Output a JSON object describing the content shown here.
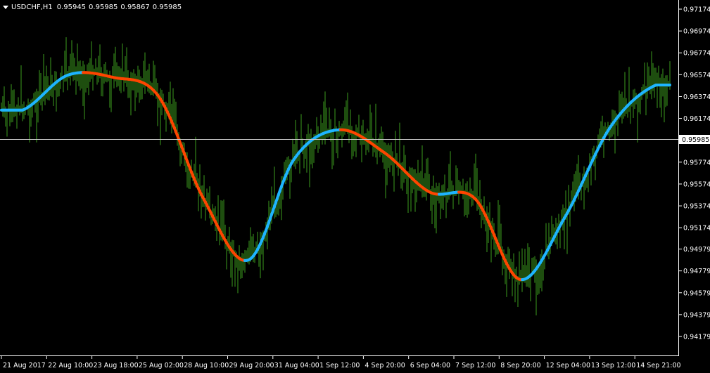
{
  "header": {
    "symbol": "USDCHF,H1",
    "open": "0.95945",
    "high": "0.95985",
    "low": "0.95867",
    "close": "0.95985"
  },
  "price_axis": {
    "ticks": [
      "0.97174",
      "0.96974",
      "0.96774",
      "0.96574",
      "0.96374",
      "0.96174",
      "0.95974",
      "0.95774",
      "0.95574",
      "0.95374",
      "0.95174",
      "0.94979",
      "0.94779",
      "0.94579",
      "0.94379",
      "0.94179"
    ],
    "current_price": "0.95985"
  },
  "time_axis": {
    "labels": [
      "21 Aug 2017",
      "22 Aug 10:00",
      "23 Aug 18:00",
      "25 Aug 02:00",
      "28 Aug 10:00",
      "29 Aug 20:00",
      "31 Aug 04:00",
      "1 Sep 12:00",
      "4 Sep 20:00",
      "6 Sep 04:00",
      "7 Sep 12:00",
      "8 Sep 20:00",
      "12 Sep 04:00",
      "13 Sep 12:00",
      "14 Sep 21:00"
    ]
  },
  "colors": {
    "background": "#000000",
    "bars": "#3c9b1e",
    "ma_up": "#1eb4ff",
    "ma_down": "#ff4500",
    "text": "#ffffff",
    "gridline": "#c8c8c8"
  },
  "chart_data": {
    "type": "line",
    "title": "USDCHF,H1",
    "x": [
      "21 Aug 2017",
      "22 Aug 10:00",
      "23 Aug 18:00",
      "25 Aug 02:00",
      "28 Aug 10:00",
      "29 Aug 20:00",
      "31 Aug 04:00",
      "1 Sep 12:00",
      "4 Sep 20:00",
      "6 Sep 04:00",
      "7 Sep 12:00",
      "8 Sep 20:00",
      "12 Sep 04:00",
      "13 Sep 12:00",
      "14 Sep 21:00"
    ],
    "ylim": [
      0.94179,
      0.97174
    ],
    "series": [
      {
        "values": [
          0.9625,
          0.9657,
          0.9655,
          0.9638,
          0.9544,
          0.9488,
          0.958,
          0.9607,
          0.9586,
          0.955,
          0.9544,
          0.947,
          0.9528,
          0.961,
          0.9648
        ]
      }
    ],
    "current_price": 0.95985,
    "grid": false
  }
}
